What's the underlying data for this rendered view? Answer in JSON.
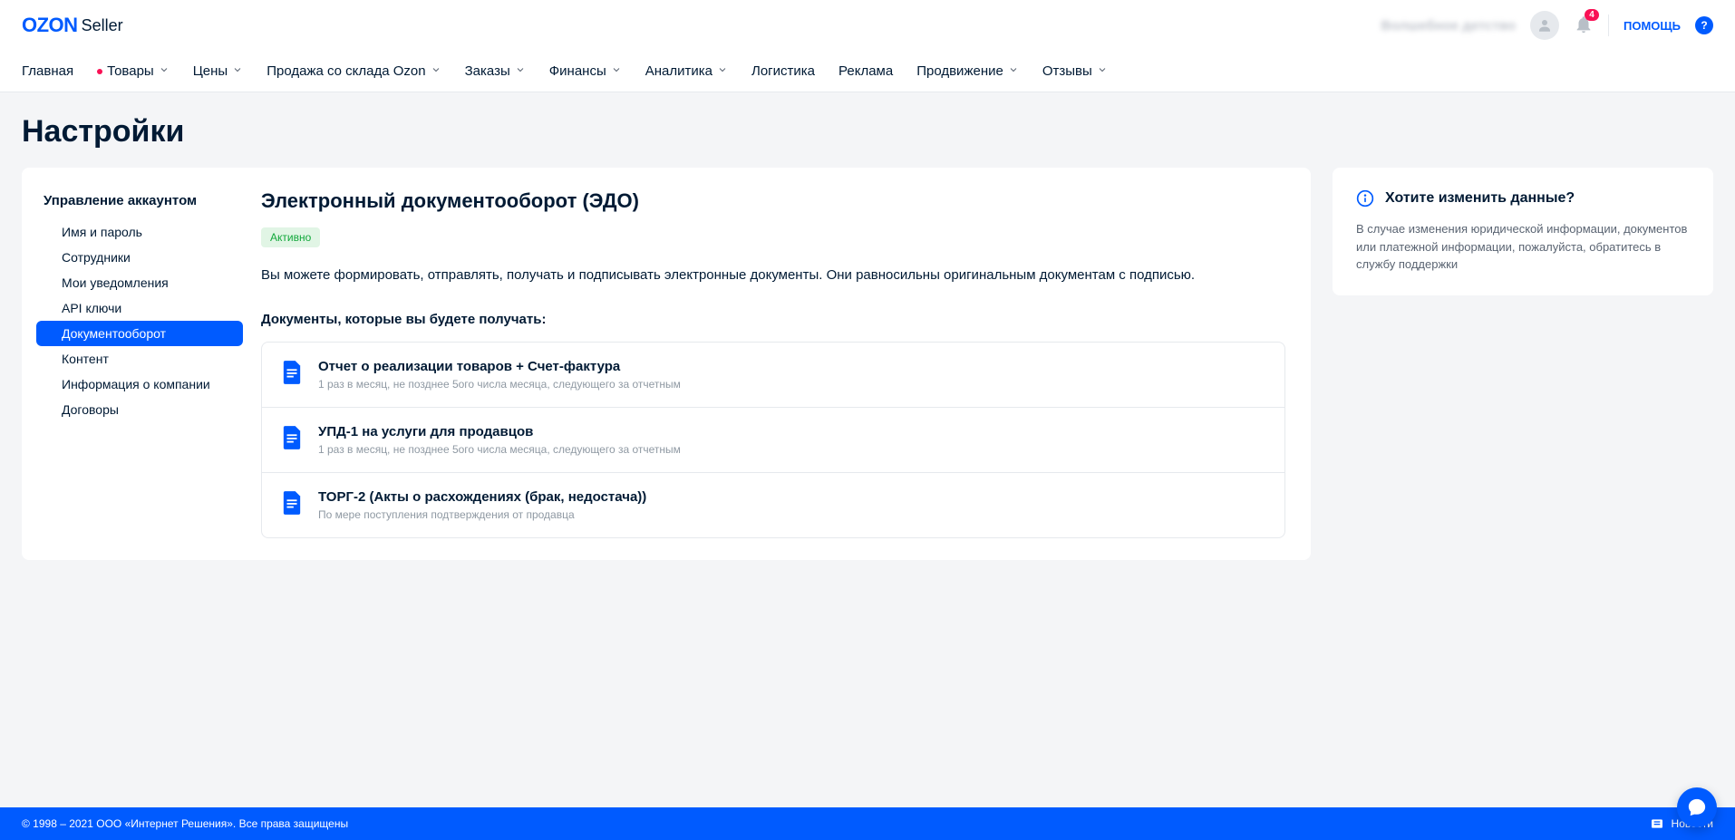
{
  "header": {
    "logo_main": "OZON",
    "logo_sub": "Seller",
    "user_blur": "Волшебное детство",
    "badge_count": "4",
    "help_label": "помощь"
  },
  "nav": {
    "items": [
      {
        "label": "Главная",
        "chevron": false,
        "dot": false
      },
      {
        "label": "Товары",
        "chevron": true,
        "dot": true
      },
      {
        "label": "Цены",
        "chevron": true,
        "dot": false
      },
      {
        "label": "Продажа со склада Ozon",
        "chevron": true,
        "dot": false
      },
      {
        "label": "Заказы",
        "chevron": true,
        "dot": false
      },
      {
        "label": "Финансы",
        "chevron": true,
        "dot": false
      },
      {
        "label": "Аналитика",
        "chevron": true,
        "dot": false
      },
      {
        "label": "Логистика",
        "chevron": false,
        "dot": false
      },
      {
        "label": "Реклама",
        "chevron": false,
        "dot": false
      },
      {
        "label": "Продвижение",
        "chevron": true,
        "dot": false
      },
      {
        "label": "Отзывы",
        "chevron": true,
        "dot": false
      }
    ]
  },
  "page_title": "Настройки",
  "sidebar": {
    "title": "Управление аккаунтом",
    "items": [
      {
        "label": "Имя и пароль"
      },
      {
        "label": "Сотрудники"
      },
      {
        "label": "Мои уведомления"
      },
      {
        "label": "API ключи"
      },
      {
        "label": "Документооборот"
      },
      {
        "label": "Контент"
      },
      {
        "label": "Информация о компании"
      },
      {
        "label": "Договоры"
      }
    ]
  },
  "main": {
    "title": "Электронный документооборот (ЭДО)",
    "status": "Активно",
    "description": "Вы можете формировать, отправлять, получать и подписывать электронные документы. Они равносильны оригинальным документам с подписью.",
    "section_title": "Документы, которые вы будете получать:",
    "docs": [
      {
        "title": "Отчет о реализации товаров + Счет-фактура",
        "sub": "1 раз в месяц, не позднее 5ого числа месяца, следующего за отчетным"
      },
      {
        "title": "УПД-1 на услуги для продавцов",
        "sub": "1 раз в месяц, не позднее 5ого числа месяца, следующего за отчетным"
      },
      {
        "title": "ТОРГ-2 (Акты о расхождениях (брак, недостача))",
        "sub": "По мере поступления подтверждения от продавца"
      }
    ]
  },
  "side": {
    "title": "Хотите изменить данные?",
    "desc": "В случае изменения юридической информации, документов или платежной информации, пожалуйста, обратитесь в службу поддержки"
  },
  "footer": {
    "copyright": "© 1998 – 2021 ООО «Интернет Решения». Все права защищены",
    "news": "Новости"
  }
}
